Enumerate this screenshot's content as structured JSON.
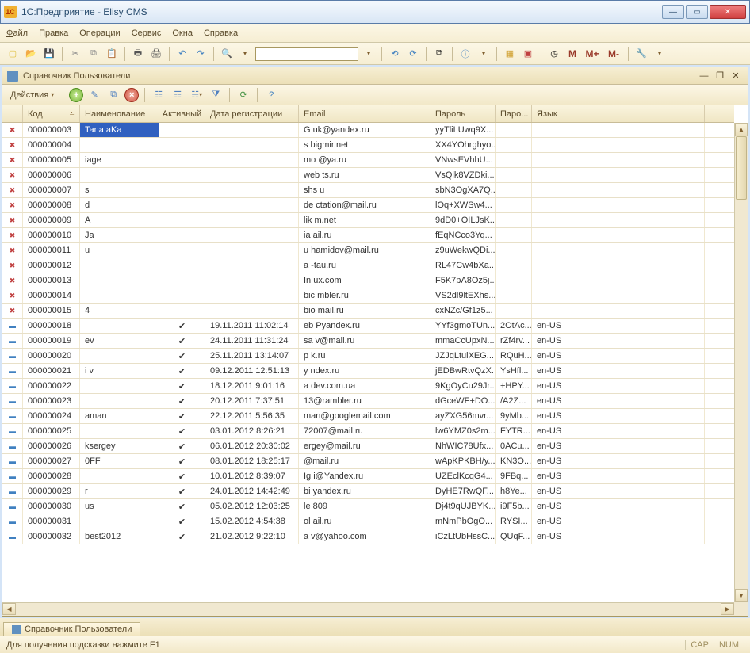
{
  "window": {
    "title": "1С:Предприятие - Elisy CMS"
  },
  "menu": {
    "file": "Файл",
    "edit": "Правка",
    "ops": "Операции",
    "svc": "Сервис",
    "win": "Окна",
    "help": "Справка"
  },
  "subwin": {
    "title": "Справочник Пользователи"
  },
  "toolbar2": {
    "actions": "Действия"
  },
  "M_labels": {
    "m": "M",
    "mp": "M+",
    "mm": "M-"
  },
  "columns": {
    "code": "Код",
    "name": "Наименование",
    "active": "Активный",
    "date": "Дата регистрации",
    "email": "Email",
    "pass": "Пароль",
    "pass2": "Паро...",
    "lang": "Язык"
  },
  "rows": [
    {
      "ic": "x",
      "code": "000000003",
      "name": "Tana aKa",
      "active": "",
      "date": "",
      "email": "G       uk@yandex.ru",
      "pass": "yyTliLUwq9X...",
      "pass2": "",
      "lang": ""
    },
    {
      "ic": "x",
      "code": "000000004",
      "name": "   ",
      "active": "",
      "date": "",
      "email": "s        bigmir.net",
      "pass": "XX4YOhrghyo...",
      "pass2": "",
      "lang": ""
    },
    {
      "ic": "x",
      "code": "000000005",
      "name": "       iage",
      "active": "",
      "date": "",
      "email": "mo        @ya.ru",
      "pass": "VNwsEVhhU...",
      "pass2": "",
      "lang": ""
    },
    {
      "ic": "x",
      "code": "000000006",
      "name": "",
      "active": "",
      "date": "",
      "email": "web        ts.ru",
      "pass": "VsQlk8VZDki...",
      "pass2": "",
      "lang": ""
    },
    {
      "ic": "x",
      "code": "000000007",
      "name": "s",
      "active": "",
      "date": "",
      "email": "shs        u",
      "pass": "sbN3OgXA7Q...",
      "pass2": "",
      "lang": ""
    },
    {
      "ic": "x",
      "code": "000000008",
      "name": "d",
      "active": "",
      "date": "",
      "email": "de      ctation@mail.ru",
      "pass": "lOq+XWSw4...",
      "pass2": "",
      "lang": ""
    },
    {
      "ic": "x",
      "code": "000000009",
      "name": "A",
      "active": "",
      "date": "",
      "email": "lik        m.net",
      "pass": "9dD0+OILJsK...",
      "pass2": "",
      "lang": ""
    },
    {
      "ic": "x",
      "code": "000000010",
      "name": "Ja",
      "active": "",
      "date": "",
      "email": "ia         ail.ru",
      "pass": "fEqNCco3Yq...",
      "pass2": "",
      "lang": ""
    },
    {
      "ic": "x",
      "code": "000000011",
      "name": "u",
      "active": "",
      "date": "",
      "email": "u      hamidov@mail.ru",
      "pass": "z9uWekwQDi...",
      "pass2": "",
      "lang": ""
    },
    {
      "ic": "x",
      "code": "000000012",
      "name": "",
      "active": "",
      "date": "",
      "email": "a        -tau.ru",
      "pass": "RL47Cw4bXa...",
      "pass2": "",
      "lang": ""
    },
    {
      "ic": "x",
      "code": "000000013",
      "name": "",
      "active": "",
      "date": "",
      "email": "In        ux.com",
      "pass": "F5K7pA8Oz5j...",
      "pass2": "",
      "lang": ""
    },
    {
      "ic": "x",
      "code": "000000014",
      "name": "",
      "active": "",
      "date": "",
      "email": "bic       mbler.ru",
      "pass": "VS2dl9ltEXhs...",
      "pass2": "",
      "lang": ""
    },
    {
      "ic": "x",
      "code": "000000015",
      "name": "      4",
      "active": "",
      "date": "",
      "email": "bio        mail.ru",
      "pass": "cxNZc/Gf1z5...",
      "pass2": "",
      "lang": ""
    },
    {
      "ic": "m",
      "code": "000000018",
      "name": "",
      "active": "✔",
      "date": "19.11.2011 11:02:14",
      "email": "eb       Pyandex.ru",
      "pass": "YYf3gmoTUn...",
      "pass2": "2OtAc...",
      "lang": "en-US"
    },
    {
      "ic": "m",
      "code": "000000019",
      "name": "       ev",
      "active": "✔",
      "date": "24.11.2011 11:31:24",
      "email": "sa      v@mail.ru",
      "pass": "mmaCcUpxN...",
      "pass2": "rZf4rv...",
      "lang": "en-US"
    },
    {
      "ic": "m",
      "code": "000000020",
      "name": "",
      "active": "✔",
      "date": "25.11.2011 13:14:07",
      "email": "p         k.ru",
      "pass": "JZJqLtuiXEG...",
      "pass2": "RQuH...",
      "lang": "en-US"
    },
    {
      "ic": "m",
      "code": "000000021",
      "name": "i       v",
      "active": "✔",
      "date": "09.12.2011 12:51:13",
      "email": "y        ndex.ru",
      "pass": "jEDBwRtvQzX...",
      "pass2": "YsHfl...",
      "lang": "en-US"
    },
    {
      "ic": "m",
      "code": "000000022",
      "name": "",
      "active": "✔",
      "date": "18.12.2011 9:01:16",
      "email": "a       dev.com.ua",
      "pass": "9KgOyCu29Jr...",
      "pass2": "+HPY...",
      "lang": "en-US"
    },
    {
      "ic": "m",
      "code": "000000023",
      "name": "",
      "active": "✔",
      "date": "20.12.2011 7:37:51",
      "email": "       13@rambler.ru",
      "pass": "dGceWF+DO...",
      "pass2": "/A2Z...",
      "lang": "en-US"
    },
    {
      "ic": "m",
      "code": "000000024",
      "name": "       aman",
      "active": "✔",
      "date": "22.12.2011 5:56:35",
      "email": "      man@googlemail.com",
      "pass": "ayZXG56mvr...",
      "pass2": "9yMb...",
      "lang": "en-US"
    },
    {
      "ic": "m",
      "code": "000000025",
      "name": "",
      "active": "✔",
      "date": "03.01.2012 8:26:21",
      "email": "       72007@mail.ru",
      "pass": "lw6YMZ0s2m...",
      "pass2": "FYTR...",
      "lang": "en-US"
    },
    {
      "ic": "m",
      "code": "000000026",
      "name": "     ksergey",
      "active": "✔",
      "date": "06.01.2012 20:30:02",
      "email": "      ergey@mail.ru",
      "pass": "NhWIC78Ufx...",
      "pass2": "0ACu...",
      "lang": "en-US"
    },
    {
      "ic": "m",
      "code": "000000027",
      "name": "     0FF",
      "active": "✔",
      "date": "08.01.2012 18:25:17",
      "email": "       @mail.ru",
      "pass": "wApKPKBH/y...",
      "pass2": "KN3O...",
      "lang": "en-US"
    },
    {
      "ic": "m",
      "code": "000000028",
      "name": "",
      "active": "✔",
      "date": "10.01.2012 8:39:07",
      "email": "Ig       i@Yandex.ru",
      "pass": "UZEclKcqG4...",
      "pass2": "9FBq...",
      "lang": "en-US"
    },
    {
      "ic": "m",
      "code": "000000029",
      "name": "     r",
      "active": "✔",
      "date": "24.01.2012 14:42:49",
      "email": "bi       yandex.ru",
      "pass": "DyHE7RwQF...",
      "pass2": "h8Ye...",
      "lang": "en-US"
    },
    {
      "ic": "m",
      "code": "000000030",
      "name": "     us",
      "active": "✔",
      "date": "05.02.2012 12:03:25",
      "email": "le        809",
      "pass": "Dj4t9qUJBYK...",
      "pass2": "i9F5b...",
      "lang": "en-US"
    },
    {
      "ic": "m",
      "code": "000000031",
      "name": "",
      "active": "✔",
      "date": "15.02.2012 4:54:38",
      "email": "ol        ail.ru",
      "pass": "mNmPbOgO...",
      "pass2": "RYSI...",
      "lang": "en-US"
    },
    {
      "ic": "m",
      "code": "000000032",
      "name": "    best2012",
      "active": "✔",
      "date": "21.02.2012 9:22:10",
      "email": "a        v@yahoo.com",
      "pass": "iCzLtUbHssC...",
      "pass2": "QUqF...",
      "lang": "en-US"
    }
  ],
  "tab": {
    "label": "Справочник Пользователи"
  },
  "status": {
    "hint": "Для получения подсказки нажмите F1",
    "cap": "CAP",
    "num": "NUM"
  }
}
